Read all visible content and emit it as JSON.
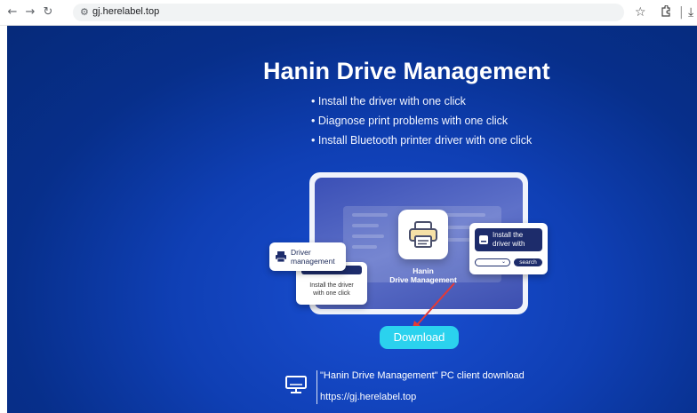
{
  "browser": {
    "url": "gj.herelabel.top",
    "icons": [
      "back-arrow-icon",
      "forward-arrow-icon",
      "reload-icon",
      "site-settings-icon",
      "star-icon",
      "extensions-icon",
      "download-icon"
    ]
  },
  "page": {
    "title": "Hanin Drive Management",
    "bullets": [
      "• Install the driver with one click",
      "• Diagnose print problems with one click",
      "• Install Bluetooth printer driver with one click"
    ],
    "illustration": {
      "center_label_line1": "Hanin",
      "center_label_line2": "Drive Management",
      "left_card_line1": "Driver",
      "left_card_line2": "management",
      "left_card2_line1": "Install the driver",
      "left_card2_line2": "with one click",
      "right_card_line1": "Install the",
      "right_card_line2": "driver with",
      "right_card_search": "search",
      "right_card_select": "⌄"
    },
    "download_label": "Download",
    "footer_line1": "\"Hanin Drive Management\" PC client download",
    "footer_line2": "https://gj.herelabel.top"
  },
  "colors": {
    "background": "#0f3fb4",
    "download_button": "#2bd2ee",
    "card_dark": "#1d2c6b",
    "arrow": "#e53935"
  }
}
